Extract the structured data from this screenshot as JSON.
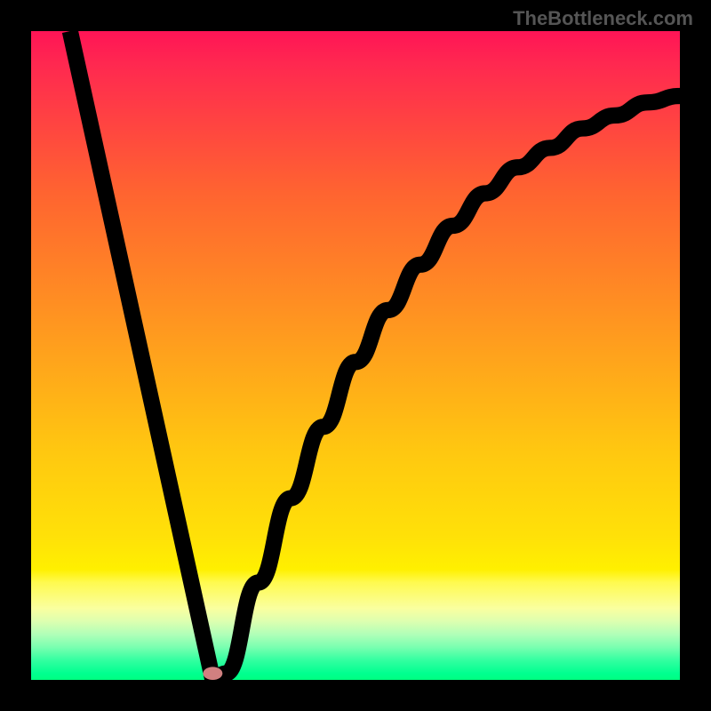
{
  "watermark": "TheBottleneck.com",
  "chart_data": {
    "type": "line",
    "title": "",
    "xlabel": "",
    "ylabel": "",
    "x_range": [
      0,
      100
    ],
    "y_range": [
      0,
      100
    ],
    "series": [
      {
        "name": "bottleneck-curve",
        "description": "V-shaped bottleneck curve with minimum point",
        "points": [
          {
            "x": 6,
            "y": 100
          },
          {
            "x": 28,
            "y": 0
          },
          {
            "x": 30,
            "y": 1
          },
          {
            "x": 35,
            "y": 15
          },
          {
            "x": 40,
            "y": 28
          },
          {
            "x": 45,
            "y": 39
          },
          {
            "x": 50,
            "y": 49
          },
          {
            "x": 55,
            "y": 57
          },
          {
            "x": 60,
            "y": 64
          },
          {
            "x": 65,
            "y": 70
          },
          {
            "x": 70,
            "y": 75
          },
          {
            "x": 75,
            "y": 79
          },
          {
            "x": 80,
            "y": 82
          },
          {
            "x": 85,
            "y": 85
          },
          {
            "x": 90,
            "y": 87
          },
          {
            "x": 95,
            "y": 89
          },
          {
            "x": 100,
            "y": 90
          }
        ]
      }
    ],
    "minimum_point": {
      "x": 28,
      "y": 0
    },
    "gradient_colors": {
      "top": "#ff1456",
      "middle": "#ffaf18",
      "bottom": "#00ff80"
    }
  },
  "marker": {
    "cx": 28,
    "cy": 99,
    "rx": 1.5,
    "ry": 1.0
  }
}
